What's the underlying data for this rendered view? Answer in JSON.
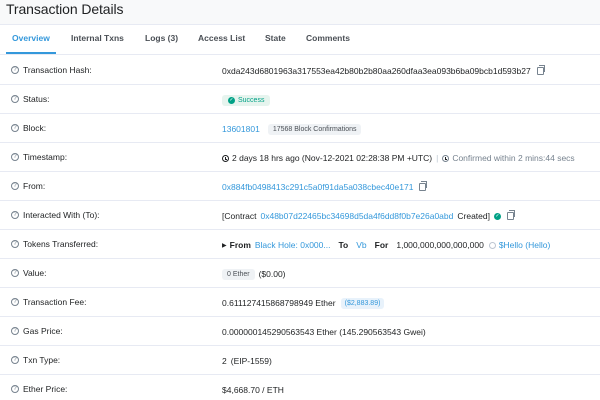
{
  "page": {
    "title": "Transaction Details"
  },
  "tabs": [
    {
      "label": "Overview"
    },
    {
      "label": "Internal Txns"
    },
    {
      "label": "Logs (3)"
    },
    {
      "label": "Access List"
    },
    {
      "label": "State"
    },
    {
      "label": "Comments"
    }
  ],
  "rows": {
    "hash": {
      "label": "Transaction Hash:",
      "value": "0xda243d6801963a317553ea42b80b2b80aa260dfaa3ea093b6ba09bcb1d593b27"
    },
    "status": {
      "label": "Status:",
      "value": "Success"
    },
    "block": {
      "label": "Block:",
      "number": "13601801",
      "confirmations": "17568 Block Confirmations"
    },
    "timestamp": {
      "label": "Timestamp:",
      "value": "2 days 18 hrs ago (Nov-12-2021 02:28:38 PM +UTC)",
      "confirmed": "Confirmed within 2 mins:44 secs"
    },
    "from": {
      "label": "From:",
      "value": "0x884fb0498413c291c5a0f91da5a038cbec40e171"
    },
    "to": {
      "label": "Interacted With (To):",
      "prefix": "[Contract",
      "address": "0x48b07d22465bc34698d5da4f6dd8f0b7e26a0abd",
      "suffix": "Created]"
    },
    "tokens": {
      "label": "Tokens Transferred:",
      "from_label": "From",
      "from_value": "Black Hole: 0x000...",
      "to_label": "To",
      "to_value": "Vb",
      "for_label": "For",
      "amount": "1,000,000,000,000,000",
      "token": "$Hello (Hello)"
    },
    "value": {
      "label": "Value:",
      "ether": "0 Ether",
      "usd": "($0.00)"
    },
    "fee": {
      "label": "Transaction Fee:",
      "value": "0.611127415868798949 Ether",
      "usd": "($2,883.89)"
    },
    "gas": {
      "label": "Gas Price:",
      "value": "0.000000145290563543 Ether (145.290563543 Gwei)"
    },
    "txntype": {
      "label": "Txn Type:",
      "value": "2",
      "type": "(EIP-1559)"
    },
    "etherprice": {
      "label": "Ether Price:",
      "value": "$4,668.70 / ETH"
    }
  },
  "colors": {
    "accent": "#3498db",
    "success": "#00a186",
    "text": "#1e2022",
    "muted": "#77838f"
  }
}
